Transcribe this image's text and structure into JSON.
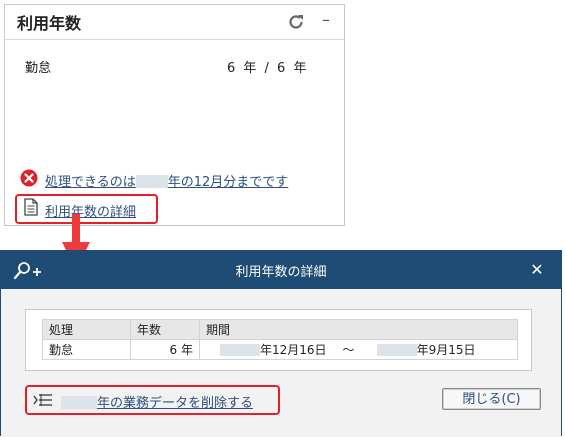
{
  "widget": {
    "title": "利用年数",
    "row_label": "勤怠",
    "row_value": "6 年  /  6 年",
    "warning_prefix": "処理できるのは",
    "warning_suffix": "年の12月分までです",
    "detail_link": "利用年数の詳細"
  },
  "dialog": {
    "title": "利用年数の詳細",
    "table": {
      "headers": [
        "処理",
        "年数",
        "期間"
      ],
      "rows": [
        {
          "process": "勤怠",
          "years": "6 年",
          "period_start": "年12月16日",
          "period_sep": "〜",
          "period_end": "年9月15日"
        }
      ]
    },
    "delete_link": "年の業務データを削除する",
    "close_button": "閉じる(C)"
  },
  "colors": {
    "titlebar": "#1e4c74",
    "link": "#2c4f7f",
    "highlight": "#e2202a",
    "error_icon": "#d9242b"
  },
  "icons": [
    "refresh-icon",
    "minimize-icon",
    "error-icon",
    "document-icon",
    "down-arrow-icon",
    "zoom-in-icon",
    "close-icon",
    "delete-list-icon"
  ]
}
